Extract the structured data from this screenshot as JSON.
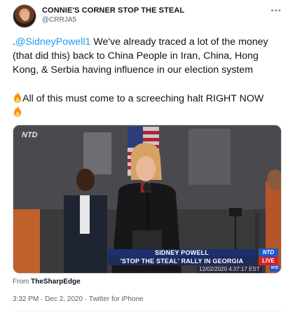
{
  "author": {
    "display_name": "CONNIE'S CORNER STOP THE STEAL",
    "handle": "@CRRJA5"
  },
  "more_icon": "more-horizontal-icon",
  "tweet": {
    "text_lead": ".",
    "mention": "@SidneyPowell1",
    "text_rest": " We've already traced a lot of the money (that did this) back to China People in Iran, China,  Hong Kong, & Serbia having influence in our election system",
    "line2": "All of this must come to a screeching halt RIGHT NOW",
    "emoji": "fire-emoji"
  },
  "video": {
    "channel_logo": "NTD",
    "lower_third_name": "SIDNEY POWELL",
    "lower_third_sub": "'STOP THE STEAL' RALLY IN GEORGIA",
    "badge_top": "NTD",
    "badge_bottom": "LIVE",
    "timestamp": "12/02/2020  4:37:17 EST",
    "corner_logo": "NTD"
  },
  "source": {
    "prefix": "From ",
    "name": "TheSharpEdge"
  },
  "meta": "3:32 PM · Dec 2, 2020 · Twitter for iPhone"
}
